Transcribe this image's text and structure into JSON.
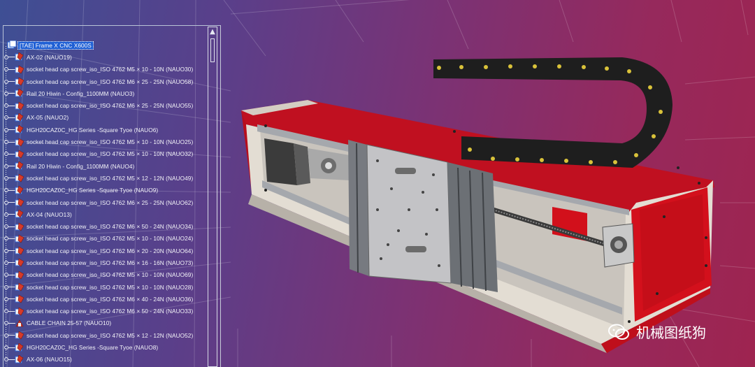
{
  "tree": {
    "root": "[TAE] Frame X CNC X600S",
    "items": [
      {
        "label": "AX-02 (NAUO19)",
        "icon": "assembly-icon"
      },
      {
        "label": "socket head cap screw_iso_ISO 4762 M5 × 10 - 10N (NAUO30)",
        "icon": "part-icon"
      },
      {
        "label": "socket head cap screw_iso_ISO 4762 M6 × 25 - 25N (NAUO58)",
        "icon": "part-icon"
      },
      {
        "label": "Rail 20 Hiwin - Config_1100MM (NAUO3)",
        "icon": "assembly-icon"
      },
      {
        "label": "socket head cap screw_iso_ISO 4762 M6 × 25 - 25N (NAUO55)",
        "icon": "part-icon"
      },
      {
        "label": "AX-05 (NAUO2)",
        "icon": "assembly-icon"
      },
      {
        "label": "HGH20CAZ0C_HG Series -Square Tyoe (NAUO6)",
        "icon": "assembly-icon"
      },
      {
        "label": "socket head cap screw_iso_ISO 4762 M5 × 10 - 10N (NAUO25)",
        "icon": "part-icon"
      },
      {
        "label": "socket head cap screw_iso_ISO 4762 M5 × 10 - 10N (NAUO32)",
        "icon": "part-icon"
      },
      {
        "label": "Rail 20 Hiwin - Config_1100MM (NAUO4)",
        "icon": "assembly-icon"
      },
      {
        "label": "socket head cap screw_iso_ISO 4762 M5 × 12 - 12N (NAUO49)",
        "icon": "part-icon"
      },
      {
        "label": "HGH20CAZ0C_HG Series -Square Tyoe (NAUO9)",
        "icon": "assembly-icon"
      },
      {
        "label": "socket head cap screw_iso_ISO 4762 M6 × 25 - 25N (NAUO62)",
        "icon": "part-icon"
      },
      {
        "label": "AX-04 (NAUO13)",
        "icon": "assembly-icon"
      },
      {
        "label": "socket head cap screw_iso_ISO 4762 M6 × 50 - 24N (NAUO34)",
        "icon": "part-icon"
      },
      {
        "label": "socket head cap screw_iso_ISO 4762 M5 × 10 - 10N (NAUO24)",
        "icon": "part-icon"
      },
      {
        "label": "socket head cap screw_iso_ISO 4762 M6 × 20 - 20N (NAUO64)",
        "icon": "part-icon"
      },
      {
        "label": "socket head cap screw_iso_ISO 4762 M6 × 16 - 16N (NAUO73)",
        "icon": "part-icon"
      },
      {
        "label": "socket head cap screw_iso_ISO 4762 M5 × 10 - 10N (NAUO69)",
        "icon": "part-icon"
      },
      {
        "label": "socket head cap screw_iso_ISO 4762 M5 × 10 - 10N (NAUO28)",
        "icon": "part-icon"
      },
      {
        "label": "socket head cap screw_iso_ISO 4762 M6 × 40 - 24N (NAUO36)",
        "icon": "part-icon"
      },
      {
        "label": "socket head cap screw_iso_ISO 4762 M6 × 50 - 24N (NAUO33)",
        "icon": "part-icon"
      },
      {
        "label": "CABLE CHAIN 25-57 (NAUO10)",
        "icon": "chain-icon"
      },
      {
        "label": "socket head cap screw_iso_ISO 4762 M5 × 12 - 12N (NAUO52)",
        "icon": "part-icon"
      },
      {
        "label": "HGH20CAZ0C_HG Series -Square Tyoe (NAUO8)",
        "icon": "assembly-icon"
      },
      {
        "label": "AX-06 (NAUO15)",
        "icon": "assembly-icon"
      }
    ]
  },
  "watermark": {
    "text": "机械图纸狗"
  },
  "colors": {
    "selection": "#1f5fd4",
    "frame_red": "#d0101a",
    "plate_grey": "#c9c4bd",
    "chain_black": "#1e1e1e",
    "bolt_yellow": "#d9c23a"
  }
}
